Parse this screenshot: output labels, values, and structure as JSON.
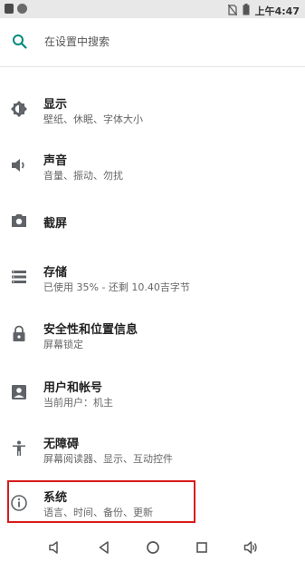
{
  "status_bar": {
    "time": "上午4:47",
    "icons": [
      "notification-square-icon",
      "circle-icon",
      "no-sim-icon",
      "battery-icon"
    ]
  },
  "search": {
    "placeholder": "在设置中搜索",
    "icon": "search-icon"
  },
  "settings": {
    "items": [
      {
        "title": "显示",
        "subtitle": "壁纸、休眠、字体大小",
        "icon": "brightness-icon"
      },
      {
        "title": "声音",
        "subtitle": "音量、振动、勿扰",
        "icon": "volume-icon"
      },
      {
        "title": "截屏",
        "subtitle": "",
        "icon": "camera-icon"
      },
      {
        "title": "存储",
        "subtitle": "已使用 35% - 还剩 10.40吉字节",
        "icon": "storage-icon"
      },
      {
        "title": "安全性和位置信息",
        "subtitle": "屏幕锁定",
        "icon": "lock-icon"
      },
      {
        "title": "用户和帐号",
        "subtitle": "当前用户：机主",
        "icon": "account-icon"
      },
      {
        "title": "无障碍",
        "subtitle": "屏幕阅读器、显示、互动控件",
        "icon": "accessibility-icon"
      },
      {
        "title": "系统",
        "subtitle": "语言、时间、备份、更新",
        "icon": "info-icon"
      }
    ]
  },
  "nav_bar": {
    "buttons": [
      "volume-down-icon",
      "back-icon",
      "home-icon",
      "recents-icon",
      "volume-up-icon"
    ]
  },
  "colors": {
    "accent": "#00897b",
    "highlight": "#d81b1b",
    "icon": "#5f6368"
  }
}
